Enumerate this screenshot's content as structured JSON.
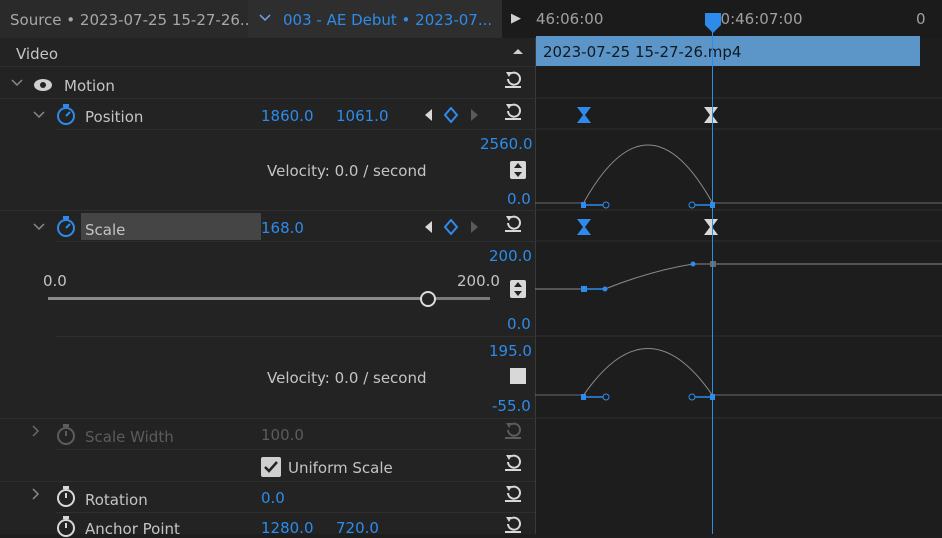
{
  "tabs": {
    "source_label": "Source • 2023-07-25 15-27-26...",
    "sequence_label": "003 - AE Debut • 2023-07...",
    "play_arrow": "▶"
  },
  "timeline": {
    "time_left": "46:06:00",
    "time_right": "00:46:07:00",
    "time_far": "0",
    "clip_name": "2023-07-25 15-27-26.mp4"
  },
  "header": {
    "section_label": "Video"
  },
  "motion": {
    "label": "Motion",
    "position": {
      "label": "Position",
      "x": "1860.0",
      "y": "1061.0",
      "graph_max": "2560.0",
      "graph_min": "0.0",
      "velocity": "Velocity: 0.0 / second"
    },
    "scale": {
      "label": "Scale",
      "value": "168.0",
      "graph_max": "200.0",
      "graph_min": "0.0",
      "slider_min": "0.0",
      "slider_max": "200.0",
      "slider_fraction": 0.86,
      "vel_max": "195.0",
      "vel_min": "-55.0",
      "velocity": "Velocity: 0.0 / second"
    },
    "scale_width": {
      "label": "Scale Width",
      "value": "100.0"
    },
    "uniform_scale": {
      "label": "Uniform Scale",
      "checked": true
    },
    "rotation": {
      "label": "Rotation",
      "value": "0.0"
    },
    "anchor_point": {
      "label": "Anchor Point",
      "x": "1280.0",
      "y": "720.0"
    }
  },
  "colors": {
    "accent": "#2d8ceb",
    "clip_bar": "#5c96c8",
    "panel": "#232323",
    "timeline_bg": "#1d1d1d"
  }
}
